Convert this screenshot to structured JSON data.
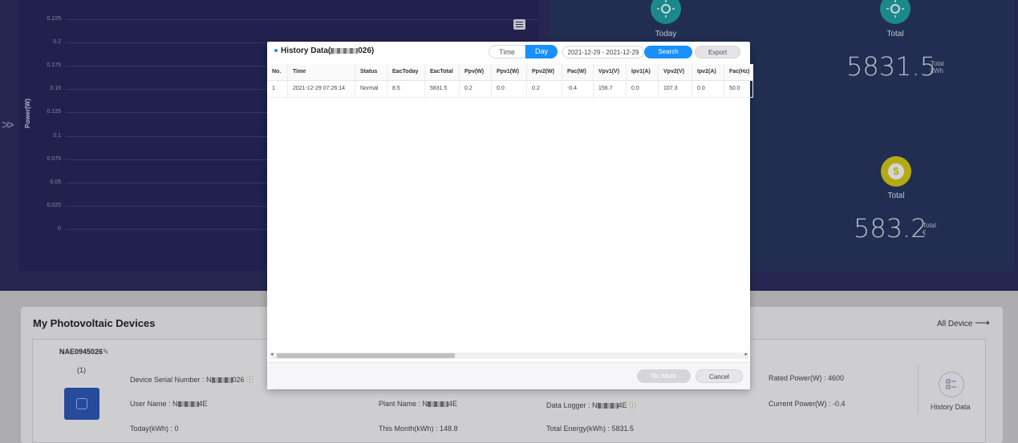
{
  "chart": {
    "ylabel": "Power(W)",
    "y_ticks": [
      "0.225",
      "0.2",
      "0.175",
      "0.15",
      "0.125",
      "0.1",
      "0.075",
      "0.05",
      "0.025",
      "0"
    ]
  },
  "stats": {
    "energy_today_label": "Today",
    "energy_total_label": "Total",
    "energy_total_value": "5831.5",
    "energy_unit_top": "Total",
    "energy_unit_bottom": "kWh",
    "money_total_label": "Total",
    "money_total_value": "583.2",
    "money_unit_top": "Total",
    "money_unit_bottom": "€",
    "money_icon": "$"
  },
  "devices": {
    "title": "My Photovoltaic Devices",
    "all_link": "All Device",
    "card": {
      "name": "NAE0945026",
      "count": "(1)",
      "serial_label": "Device Serial Number : N",
      "serial_tail": "026",
      "user_label": "User Name : N",
      "user_tail": "4E",
      "plant_label": "Plant Name : N",
      "plant_tail": "4E",
      "logger_label": "Data Logger : N",
      "logger_tail": "4E",
      "today_label": "Today(kWh) : 0",
      "month_label": "This Month(kWh) : 148.8",
      "total_label": "Total Energy(kWh) : 5831.5",
      "rated_label": "Rated Power(W) : 4600",
      "current_label": "Current Power(W) : -0.4",
      "history_label": "History Data"
    }
  },
  "modal": {
    "title_prefix": "History Data(",
    "title_suffix": "026)",
    "tab_time": "Time",
    "tab_day": "Day",
    "date_range": "2021-12-29 - 2021-12-29",
    "search": "Search",
    "export": "Export",
    "columns": [
      "No.",
      "Time",
      "Status",
      "EacToday",
      "EacTotal",
      "Ppv(W)",
      "Ppv1(W)",
      "Ppv2(W)",
      "Pac(W)",
      "Vpv1(V)",
      "Ipv1(A)",
      "Vpv2(V)",
      "Ipv2(A)",
      "Fac(Hz)"
    ],
    "rows": [
      [
        "1",
        "2021-12-29 07:26:14",
        "Normal",
        "8.5",
        "5831.5",
        "0.2",
        "0.0",
        "0.2",
        "-0.4",
        "156.7",
        "0.0",
        "107.3",
        "0.0",
        "50.0"
      ]
    ],
    "no_more": "No More",
    "cancel": "Cancel"
  }
}
